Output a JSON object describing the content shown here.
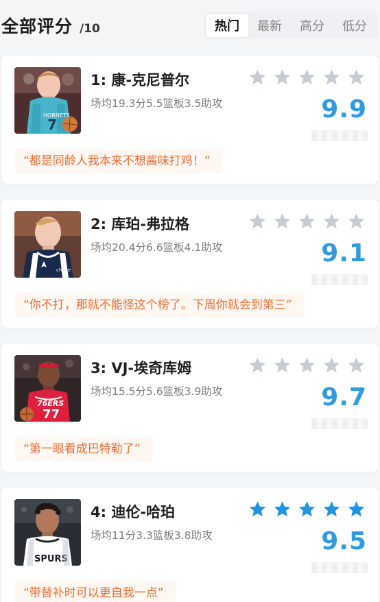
{
  "header": {
    "title": "全部评分",
    "subtitle": "/10",
    "tabs": [
      {
        "label": "热门",
        "active": true
      },
      {
        "label": "最新",
        "active": false
      },
      {
        "label": "高分",
        "active": false
      },
      {
        "label": "低分",
        "active": false
      }
    ]
  },
  "cards": [
    {
      "rank_name": "1:  康-克尼普尔",
      "stats": "场均19.3分5.5篮板3.5助攻",
      "score": "9.9",
      "stars_state": "gray",
      "quote": "“都是同龄人我本来不想酱味打鸡！”",
      "avatar_icon": "player-photo-hornets"
    },
    {
      "rank_name": "2:  库珀-弗拉格",
      "stats": "场均20.4分6.6篮板4.1助攻",
      "score": "9.1",
      "stars_state": "gray",
      "quote": "“你不打，那就不能怪这个榜了。下周你就会到第三”",
      "avatar_icon": "player-photo-mavericks"
    },
    {
      "rank_name": "3:  VJ-埃奇库姆",
      "stats": "场均15.5分5.6篮板3.9助攻",
      "score": "9.7",
      "stars_state": "gray",
      "quote": "“第一眼看成巴特勒了”",
      "avatar_icon": "player-photo-76ers"
    },
    {
      "rank_name": "4:  迪伦-哈珀",
      "stats": "场均11分3.3篮板3.8助攻",
      "score": "9.5",
      "stars_state": "blue",
      "quote": "“带替补时可以更自我一点”",
      "avatar_icon": "player-photo-spurs"
    }
  ],
  "colors": {
    "score_blue": "#2f9be3",
    "star_gray": "#c8cbd3",
    "star_blue": "#1e94e3",
    "quote_orange": "#ea6d37",
    "quote_bg": "#fff7f1"
  }
}
